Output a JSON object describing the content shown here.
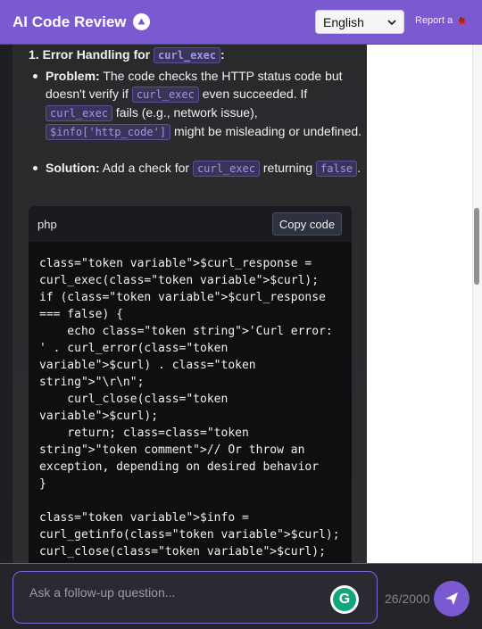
{
  "header": {
    "title": "AI Code Review",
    "language_selected": "English",
    "report_label": "Report a"
  },
  "content": {
    "heading_number": "1. Error Handling for",
    "heading_code": "curl_exec",
    "heading_tail": ":",
    "problem_label": "Problem:",
    "problem_text_1": "The code checks the HTTP status code but doesn't verify if",
    "problem_code_1": "curl_exec",
    "problem_text_2": "even succeeded. If",
    "problem_code_2": "curl_exec",
    "problem_text_3": "fails (e.g., network issue),",
    "problem_code_3": "$info['http_code']",
    "problem_text_4": "might be misleading or undefined.",
    "solution_label": "Solution:",
    "solution_text_1": "Add a check for",
    "solution_code_1": "curl_exec",
    "solution_text_2": "returning",
    "solution_code_2": "false",
    "solution_text_3": "."
  },
  "codeblock": {
    "language": "php",
    "copy_label": "Copy code",
    "lines": [
      "class=\"token variable\">$curl_response =",
      "curl_exec(class=\"token variable\">$curl);",
      "if (class=\"token variable\">$curl_response",
      "=== false) {",
      "    echo class=\"token string\">'Curl error:",
      "' . curl_error(class=\"token",
      "variable\">$curl) . class=\"token",
      "string\">\"\\r\\n\";",
      "    curl_close(class=\"token",
      "variable\">$curl);",
      "    return; class=class=\"token",
      "string\">\"token comment\">// Or throw an",
      "exception, depending on desired behavior",
      "}",
      "",
      "class=\"token variable\">$info =",
      "curl_getinfo(class=\"token variable\">$curl);",
      "curl_close(class=\"token variable\">$curl);"
    ]
  },
  "footer": {
    "placeholder": "Ask a follow-up question...",
    "char_count": "26/2000",
    "grammarly_letter": "G"
  },
  "colors": {
    "accent": "#7b5ad1",
    "inline_code": "#a394ec",
    "panel_bg": "#2b2b2e"
  }
}
